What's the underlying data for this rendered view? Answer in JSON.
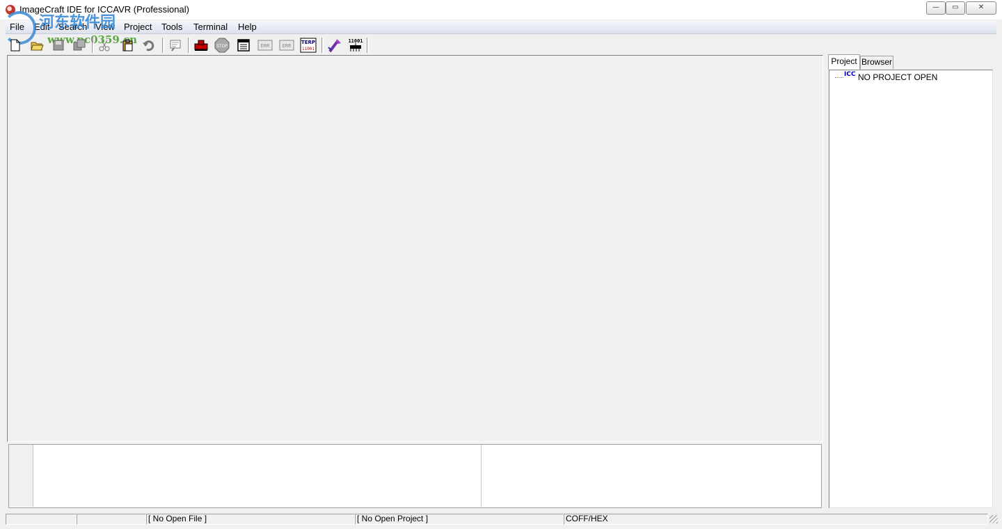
{
  "window": {
    "title": "ImageCraft IDE for ICCAVR (Professional)",
    "controls": {
      "minimize": "—",
      "maximize": "▭",
      "close": "✕"
    }
  },
  "watermark": {
    "text": "河东软件园",
    "url": "www.pc0359.cn"
  },
  "menu": {
    "items": [
      "File",
      "Edit",
      "Search",
      "View",
      "Project",
      "Tools",
      "Terminal",
      "Help"
    ]
  },
  "toolbar": {
    "buttons": [
      {
        "icon": "new-file-icon"
      },
      {
        "icon": "open-folder-icon"
      },
      {
        "icon": "save-icon"
      },
      {
        "icon": "save-all-icon"
      },
      {
        "icon": "cut-icon"
      },
      {
        "icon": "paste-icon"
      },
      {
        "icon": "undo-icon"
      },
      {
        "icon": "find-icon"
      },
      {
        "icon": "build-icon"
      },
      {
        "icon": "stop-icon"
      },
      {
        "icon": "options-icon"
      },
      {
        "icon": "prev-error-icon"
      },
      {
        "icon": "next-error-icon"
      },
      {
        "icon": "terminal-icon"
      },
      {
        "icon": "wizard-icon"
      },
      {
        "icon": "chip-programmer-icon"
      }
    ],
    "labels": {
      "stop": "STOP",
      "err": "ERR",
      "terp": "TERP",
      "binary": "11001"
    }
  },
  "sidebar": {
    "tabs": [
      "Project",
      "Browser"
    ],
    "active_tab": "Project",
    "tree": {
      "icon_text": "ICC",
      "label": "NO PROJECT OPEN"
    }
  },
  "statusbar": {
    "panes": [
      "",
      "",
      "[ No Open File ]",
      "[ No Open Project ]",
      "COFF/HEX"
    ]
  },
  "colors": {
    "menubar": "#dde2ee",
    "background": "#f0f0f0",
    "accent_blue": "#0000b0",
    "watermark_blue": "#3a8ad6",
    "watermark_green": "#5aa840"
  }
}
